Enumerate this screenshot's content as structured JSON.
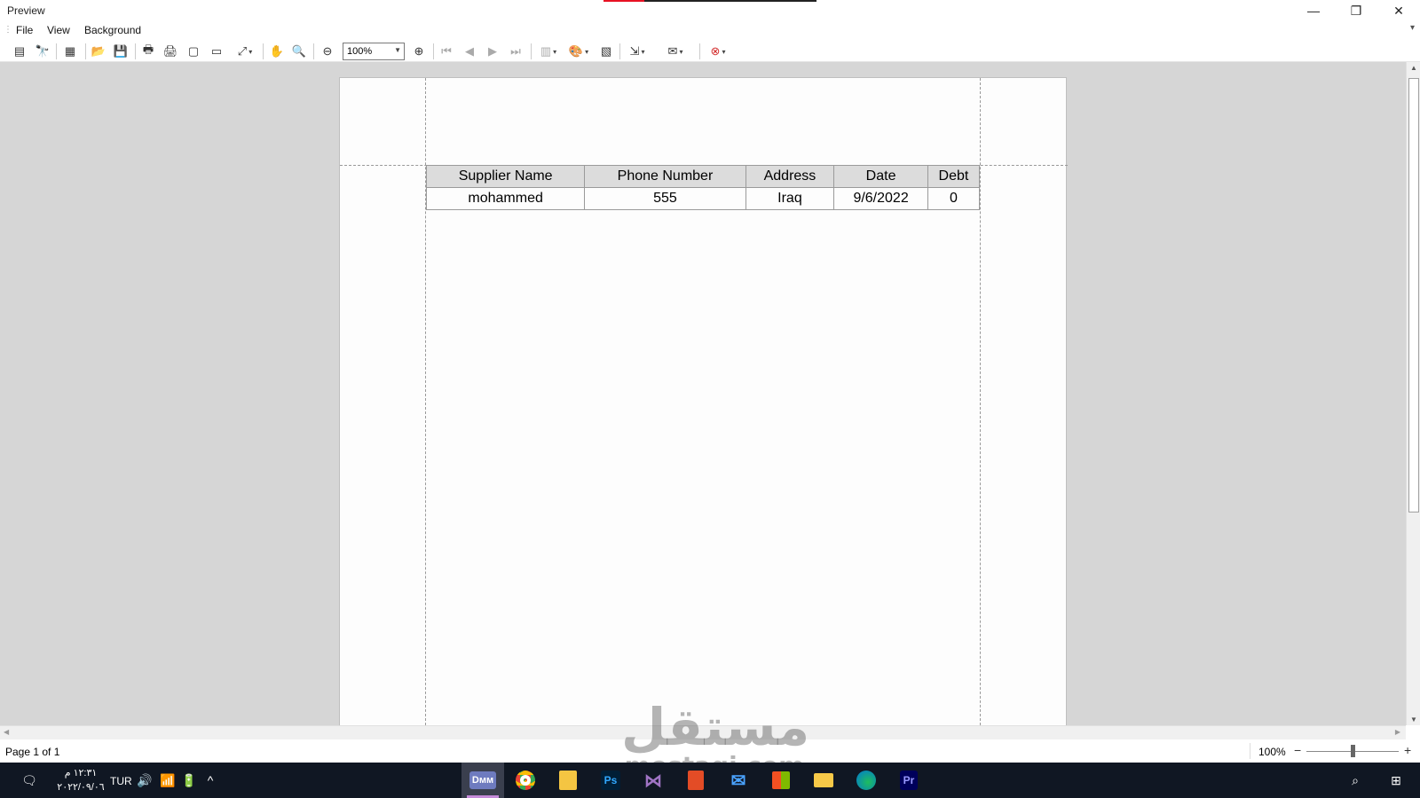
{
  "window": {
    "title": "Preview",
    "controls": {
      "minimize": "—",
      "restore": "❐",
      "close": "✕"
    }
  },
  "menu": {
    "items": [
      {
        "label": "File"
      },
      {
        "label": "View"
      },
      {
        "label": "Background"
      }
    ]
  },
  "toolbar": {
    "zoom_value": "100%",
    "icons": [
      "toc-icon",
      "find-icon",
      "parameters-icon",
      "open-icon",
      "save-icon",
      "print-icon",
      "quick-print-icon",
      "page-setup-icon",
      "header-footer-icon",
      "scale-icon",
      "hand-tool-icon",
      "magnifier-icon",
      "zoom-out-icon",
      "zoom-in-icon",
      "first-page-icon",
      "previous-page-icon",
      "next-page-icon",
      "last-page-icon",
      "multiple-pages-icon",
      "color-icon",
      "watermark-icon",
      "export-icon",
      "email-icon",
      "close-preview-icon"
    ]
  },
  "report": {
    "columns": [
      "Supplier Name",
      "Phone Number",
      "Address",
      "Date",
      "Debt"
    ],
    "rows": [
      [
        "mohammed",
        "555",
        "Iraq",
        "9/6/2022",
        "0"
      ]
    ]
  },
  "status": {
    "page": "Page 1 of 1",
    "zoom": "100%",
    "zoom_level": 1.0
  },
  "taskbar": {
    "clock_time": "١٢:٣١ م",
    "clock_date": "٢٠٢٢/٠٩/٠٦",
    "language": "TUR",
    "apps": [
      {
        "name": "dmm",
        "label": "Dмм"
      },
      {
        "name": "chrome",
        "label": ""
      },
      {
        "name": "sticky",
        "label": ""
      },
      {
        "name": "photoshop",
        "label": "Ps"
      },
      {
        "name": "visual-studio",
        "label": ""
      },
      {
        "name": "office",
        "label": ""
      },
      {
        "name": "mail",
        "label": ""
      },
      {
        "name": "store",
        "label": ""
      },
      {
        "name": "explorer",
        "label": ""
      },
      {
        "name": "edge",
        "label": ""
      },
      {
        "name": "premiere",
        "label": "Pr"
      }
    ]
  },
  "watermark": {
    "arabic": "مستقل",
    "latin": "mostaqi.com"
  }
}
